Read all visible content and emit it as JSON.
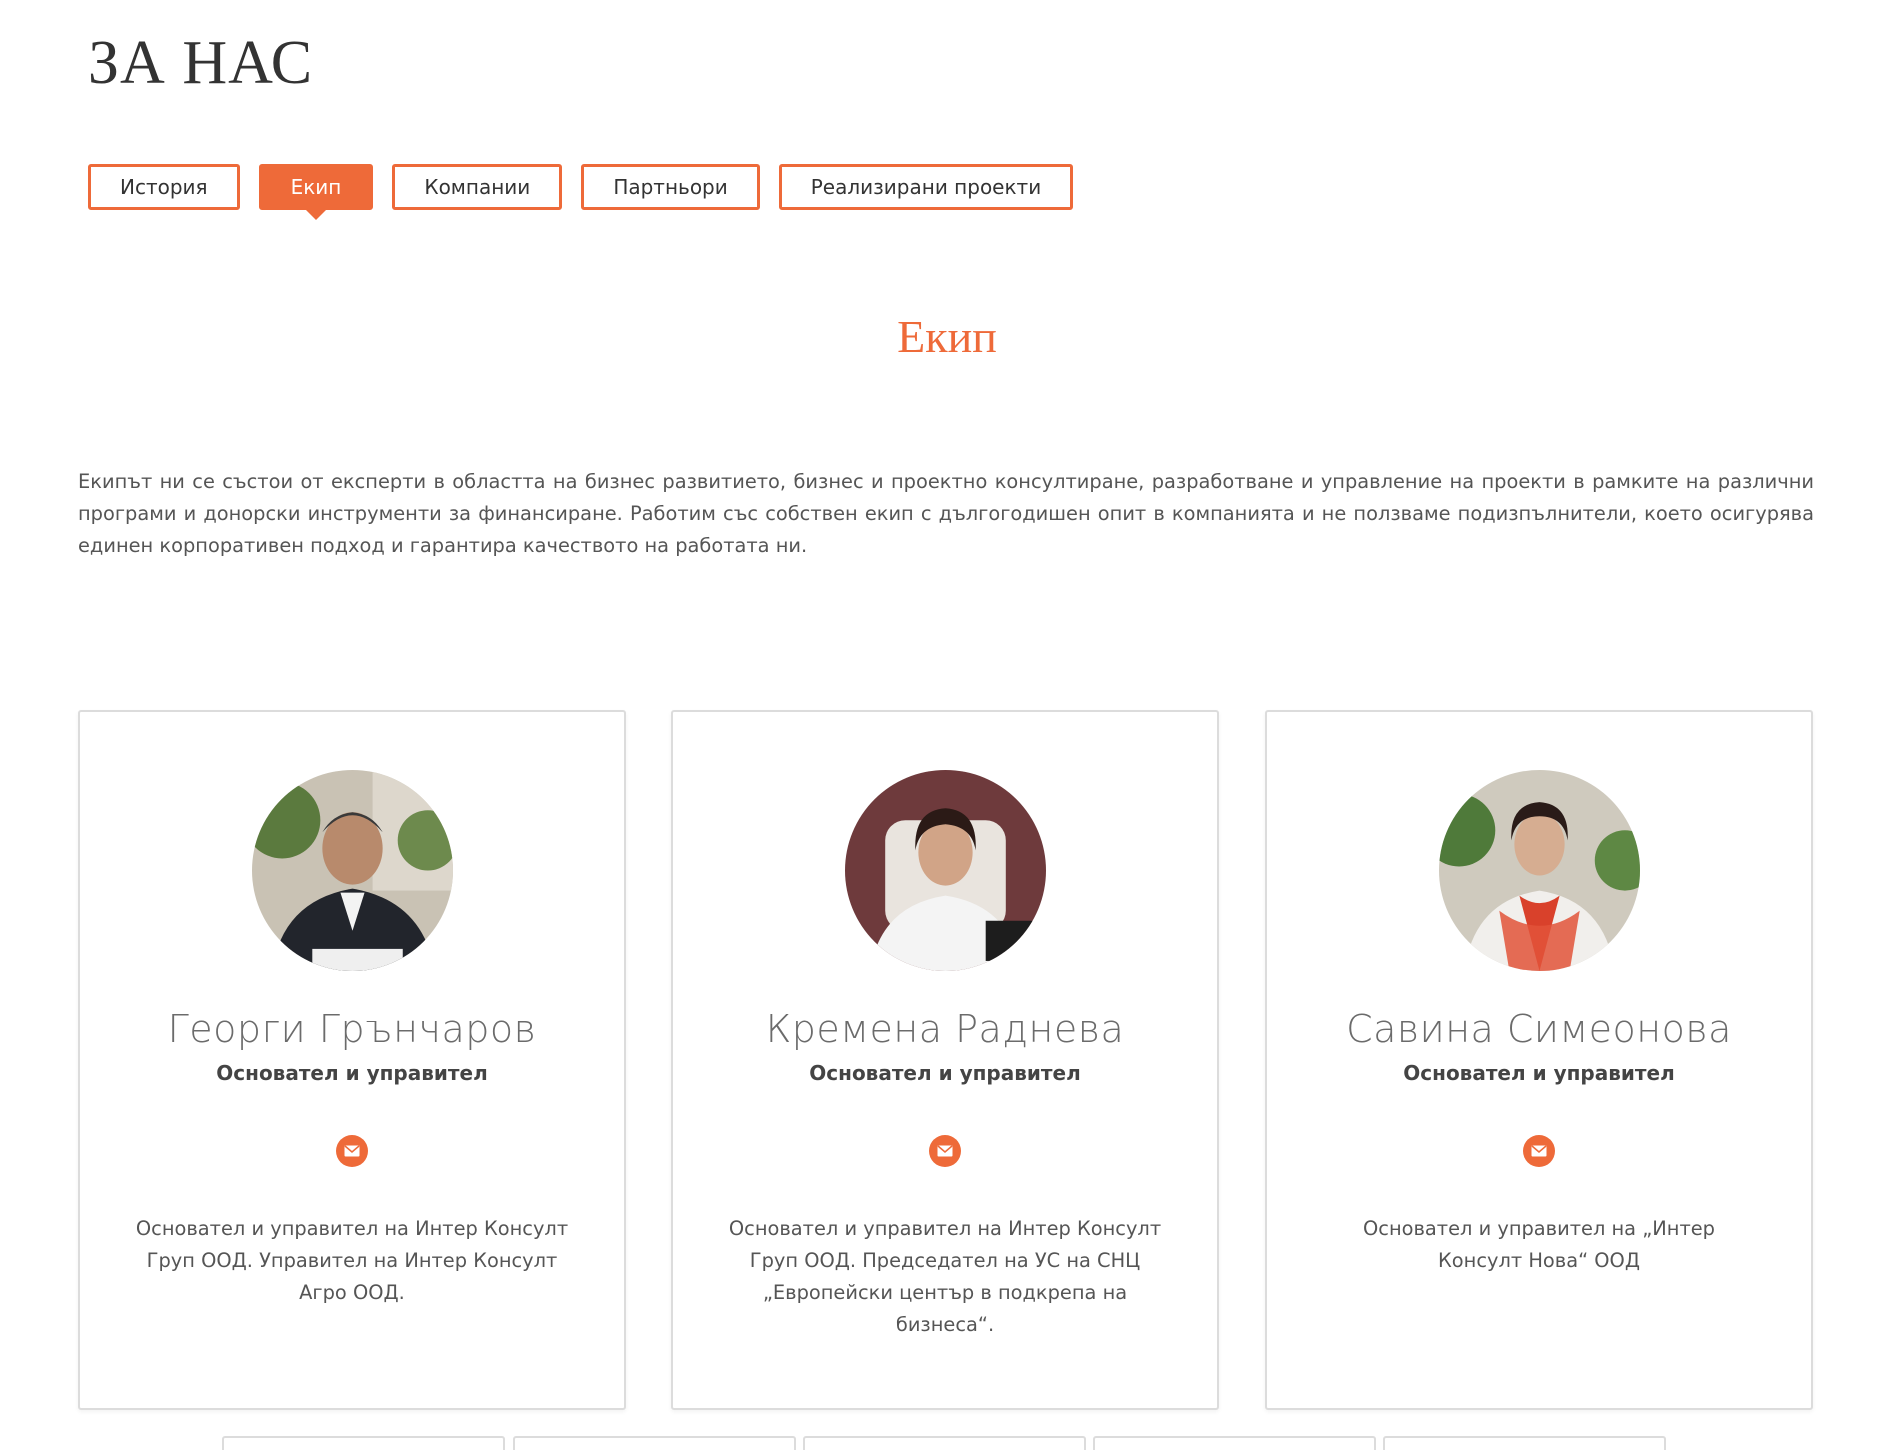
{
  "page": {
    "title": "ЗА НАС"
  },
  "tabs": [
    {
      "label": "История",
      "active": false
    },
    {
      "label": "Екип",
      "active": true
    },
    {
      "label": "Компании",
      "active": false
    },
    {
      "label": "Партньори",
      "active": false
    },
    {
      "label": "Реализирани проекти",
      "active": false
    }
  ],
  "section": {
    "heading": "Екип",
    "intro": "Екипът ни се състои от експерти в областта на бизнес развитието, бизнес и проектно консултиране, разработване и управление на проекти в рамките на различни програми и донорски инструменти за финансиране. Работим със собствен екип с дългогодишен опит в компанията и не ползваме подизпълнители, което осигурява единен корпоративен подход и гарантира качеството на работата ни."
  },
  "team": [
    {
      "name": "Георги Грънчаров",
      "role": "Основател и управител",
      "bio": "Основател и управител на Интер Консулт Груп ООД. Управител на Интер Консулт Агро ООД.",
      "icon": "envelope-icon"
    },
    {
      "name": "Кремена Раднева",
      "role": "Основател и управител",
      "bio": "Основател и управител на Интер Консулт Груп ООД. Председател на УС на СНЦ „Европейски център в подкрепа на бизнеса“.",
      "icon": "envelope-icon"
    },
    {
      "name": "Савина Симеонова",
      "role": "Основател и управител",
      "bio": "Основател и управител на „Интер Консулт Нова“ ООД",
      "icon": "envelope-icon"
    }
  ],
  "colors": {
    "accent": "#ee6a39",
    "border": "#dcdcdc",
    "text": "#444444"
  }
}
